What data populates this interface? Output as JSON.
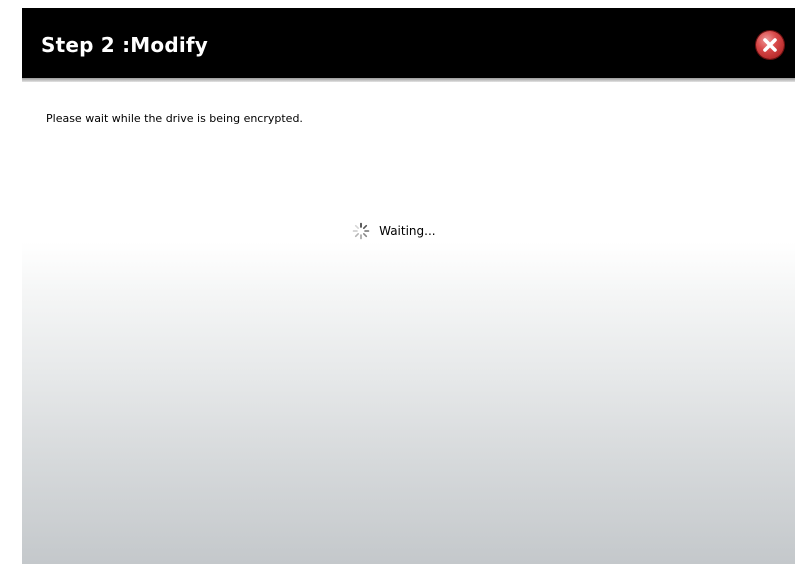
{
  "dialog": {
    "title": "Step 2 :Modify",
    "close_icon": "close-x-icon",
    "message": "Please wait while the drive is being encrypted.",
    "status": {
      "icon": "loading-spinner-icon",
      "label": "Waiting..."
    }
  },
  "colors": {
    "title_bar": "#000000",
    "title_text": "#ffffff",
    "close_button": "#d84848"
  }
}
